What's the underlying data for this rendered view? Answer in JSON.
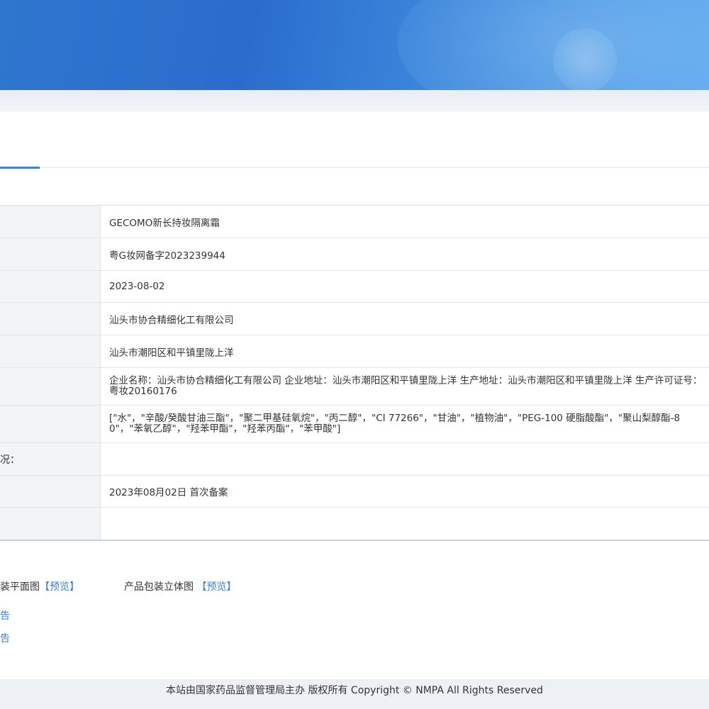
{
  "table": {
    "rows": [
      {
        "label": "",
        "value": "GECOMO新长持妆隔离霜"
      },
      {
        "label": "",
        "value": "粤G妆网备字2023239944"
      },
      {
        "label": "",
        "value": "2023-08-02"
      },
      {
        "label": "",
        "value": "汕头市协合精细化工有限公司"
      },
      {
        "label": "",
        "value": "汕头市潮阳区和平镇里陇上洋"
      },
      {
        "label": "",
        "value": "企业名称：汕头市协合精细化工有限公司 企业地址：汕头市潮阳区和平镇里陇上洋 生产地址：汕头市潮阳区和平镇里陇上洋 生产许可证号：粤妆20160176"
      },
      {
        "label": "",
        "value": "[\"水\"，\"辛酸/癸酸甘油三酯\"，\"聚二甲基硅氧烷\"，\"丙二醇\"，\"CI 77266\"，\"甘油\"，\"植物油\"，\"PEG-100 硬脂酸酯\"，\"聚山梨醇酯-80\"，\"苯氧乙醇\"，\"羟苯甲酯\"，\"羟苯丙酯\"，\"苯甲酸\"]"
      },
      {
        "label": "况：",
        "value": ""
      },
      {
        "label": "",
        "value": "2023年08月02日 首次备案"
      },
      {
        "label": "",
        "value": ""
      }
    ]
  },
  "attachments": {
    "item1_label": "装平面图",
    "item1_link": "【预览】",
    "item2_label": "产品包装立体图",
    "item2_link": "【预览】",
    "side_link1": "告",
    "side_link2": "告"
  },
  "footer": {
    "text": "本站由国家药品监督管理局主办 版权所有 Copyright © NMPA All Rights Reserved"
  },
  "colors": {
    "banner": "#2f76cf",
    "link": "#3a7fd0",
    "tab_accent": "#3b86d6"
  }
}
